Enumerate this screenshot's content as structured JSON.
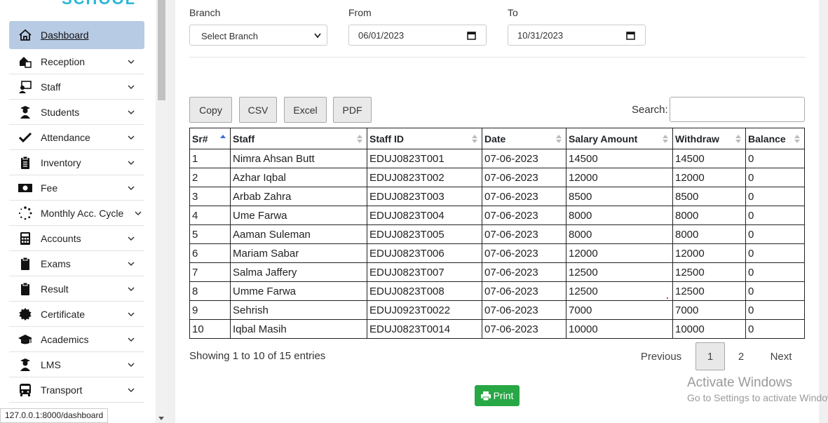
{
  "app": {
    "logo_fragment": "SCHOOL",
    "status_url": "127.0.0.1:8000/dashboard"
  },
  "sidebar": {
    "items": [
      {
        "label": "Dashboard",
        "icon": "home-icon"
      },
      {
        "label": "Reception",
        "icon": "reception-icon"
      },
      {
        "label": "Staff",
        "icon": "staff-icon"
      },
      {
        "label": "Students",
        "icon": "students-icon"
      },
      {
        "label": "Attendance",
        "icon": "check-icon"
      },
      {
        "label": "Inventory",
        "icon": "clipboard-list-icon"
      },
      {
        "label": "Fee",
        "icon": "money-icon"
      },
      {
        "label": "Monthly Acc. Cycle",
        "icon": "spinner-icon"
      },
      {
        "label": "Accounts",
        "icon": "calculator-icon"
      },
      {
        "label": "Exams",
        "icon": "clipboard-icon"
      },
      {
        "label": "Result",
        "icon": "clipboard-icon"
      },
      {
        "label": "Certificate",
        "icon": "certificate-icon"
      },
      {
        "label": "Academics",
        "icon": "graduation-cap-icon"
      },
      {
        "label": "LMS",
        "icon": "graduate-icon"
      },
      {
        "label": "Transport",
        "icon": "bus-icon"
      }
    ]
  },
  "filters": {
    "branch_label": "Branch",
    "branch_value": "Select Branch",
    "from_label": "From",
    "from_value": "06/01/2023",
    "to_label": "To",
    "to_value": "10/31/2023"
  },
  "export_buttons": {
    "copy": "Copy",
    "csv": "CSV",
    "excel": "Excel",
    "pdf": "PDF"
  },
  "search": {
    "label": "Search:",
    "value": ""
  },
  "table": {
    "headers": [
      "Sr#",
      "Staff",
      "Staff ID",
      "Date",
      "Salary Amount",
      "Withdraw",
      "Balance"
    ],
    "rows": [
      [
        "1",
        "Nimra Ahsan Butt",
        "EDUJ0823T001",
        "07-06-2023",
        "14500",
        "14500",
        "0"
      ],
      [
        "2",
        "Azhar Iqbal",
        "EDUJ0823T002",
        "07-06-2023",
        "12000",
        "12000",
        "0"
      ],
      [
        "3",
        "Arbab Zahra",
        "EDUJ0823T003",
        "07-06-2023",
        "8500",
        "8500",
        "0"
      ],
      [
        "4",
        "Ume Farwa",
        "EDUJ0823T004",
        "07-06-2023",
        "8000",
        "8000",
        "0"
      ],
      [
        "5",
        "Aaman Suleman",
        "EDUJ0823T005",
        "07-06-2023",
        "8000",
        "8000",
        "0"
      ],
      [
        "6",
        "Mariam Sabar",
        "EDUJ0823T006",
        "07-06-2023",
        "12000",
        "12000",
        "0"
      ],
      [
        "7",
        "Salma Jaffery",
        "EDUJ0823T007",
        "07-06-2023",
        "12500",
        "12500",
        "0"
      ],
      [
        "8",
        "Umme Farwa",
        "EDUJ0823T008",
        "07-06-2023",
        "12500",
        "12500",
        "0"
      ],
      [
        "9",
        "Sehrish",
        "EDUJ0923T0022",
        "07-06-2023",
        "7000",
        "7000",
        "0"
      ],
      [
        "10",
        "Iqbal Masih",
        "EDUJ0823T0014",
        "07-06-2023",
        "10000",
        "10000",
        "0"
      ]
    ]
  },
  "pagination": {
    "info": "Showing 1 to 10 of 15 entries",
    "previous": "Previous",
    "page1": "1",
    "page2": "2",
    "next": "Next"
  },
  "print_button": "Print",
  "watermark": {
    "line1": "Activate Windows",
    "line2": "Go to Settings to activate Windows."
  },
  "colors": {
    "active_menu": "#b8cbe4",
    "print": "#28a745",
    "logo": "#29b6d6"
  }
}
